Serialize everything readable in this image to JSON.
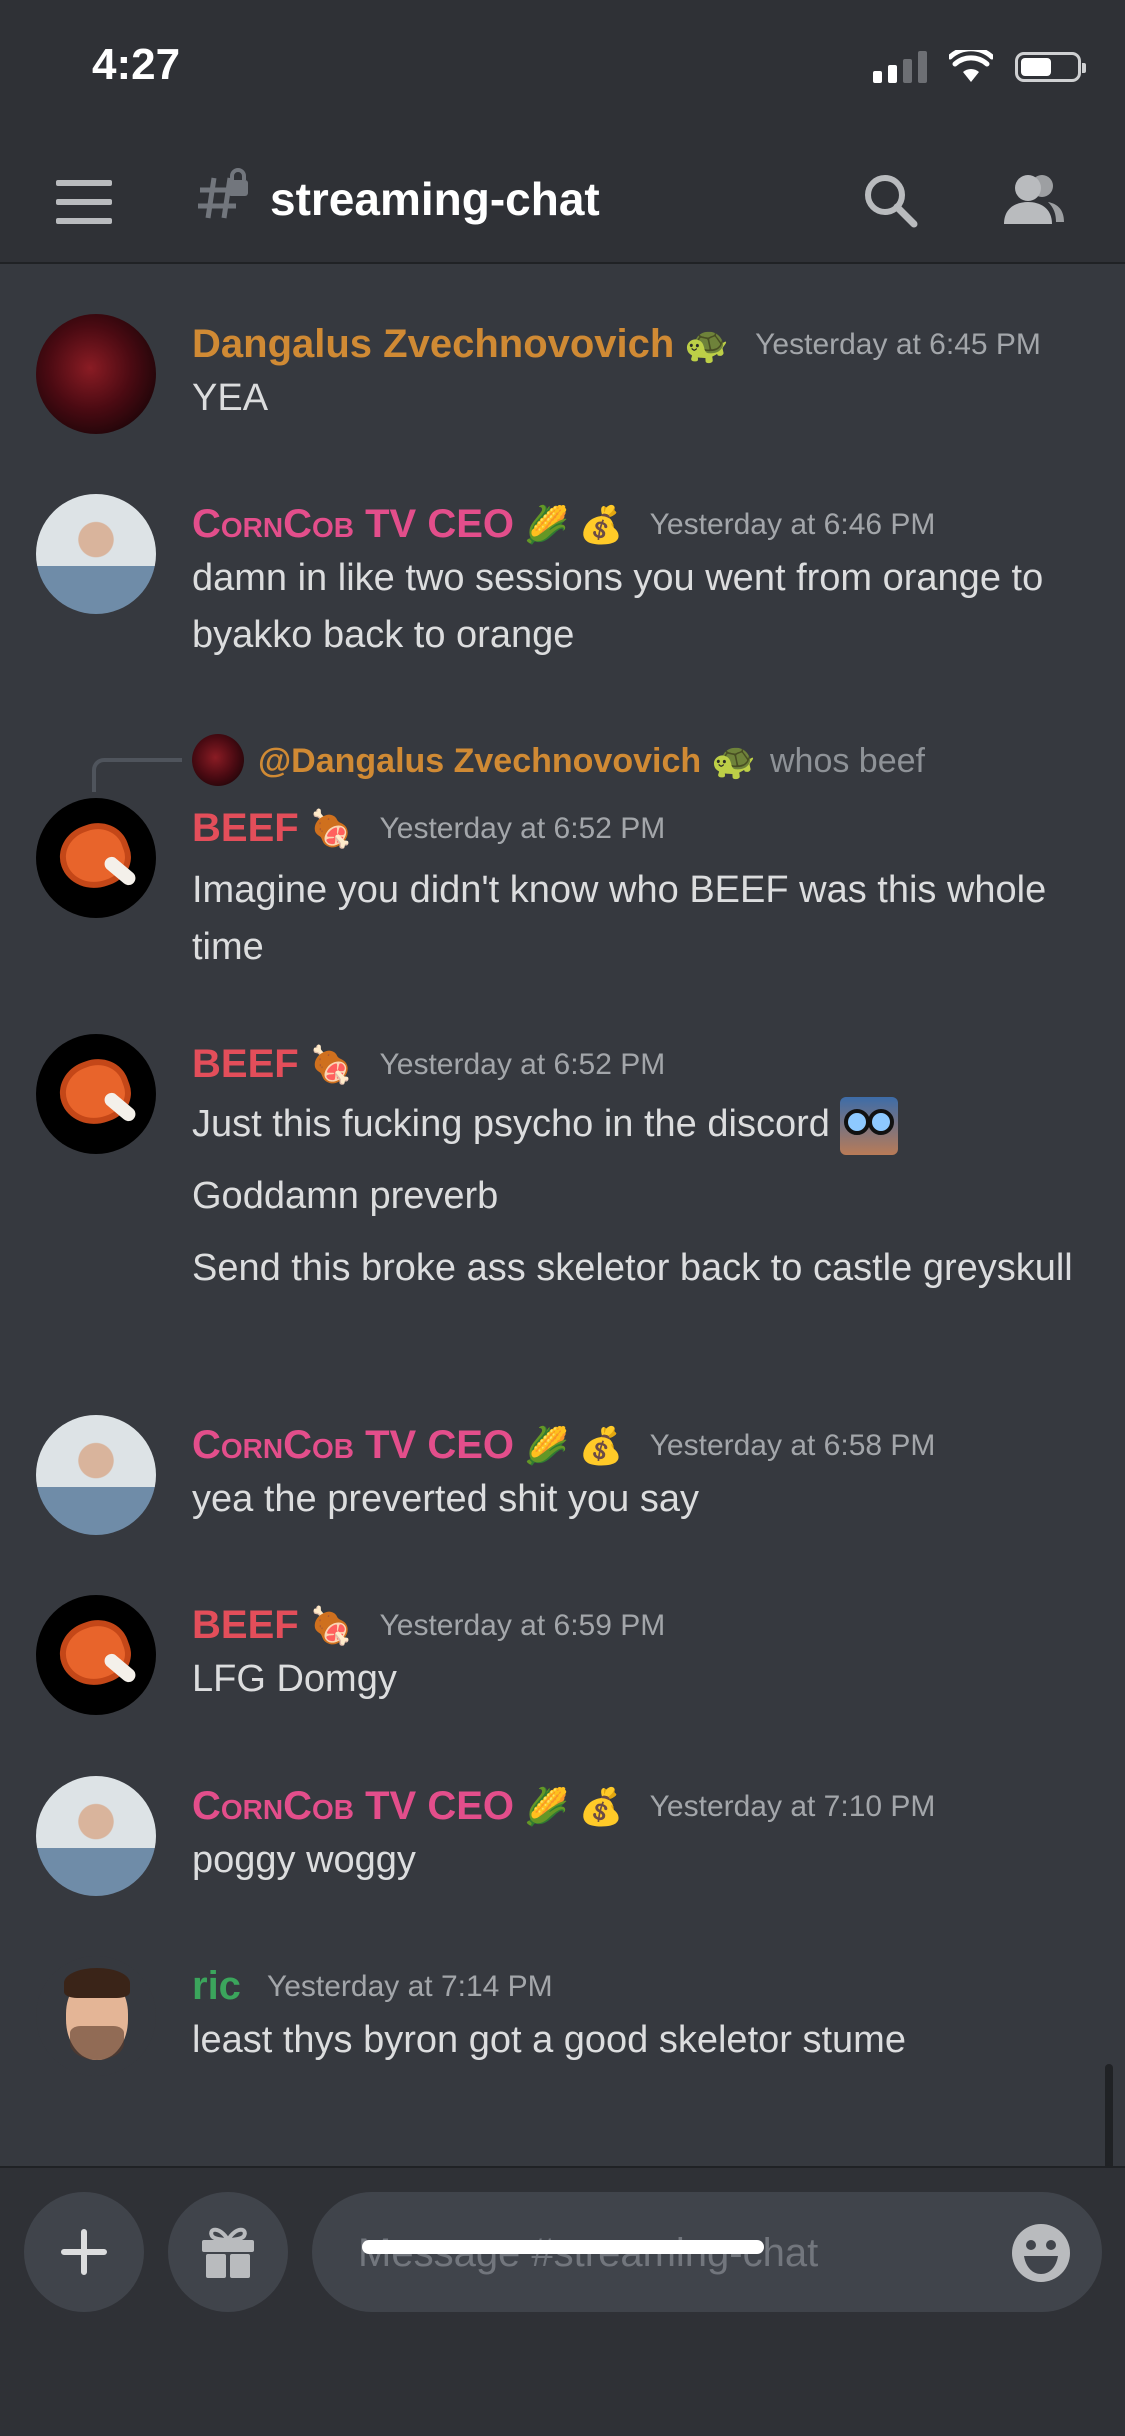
{
  "status_bar": {
    "time": "4:27"
  },
  "header": {
    "channel_name": "streaming-chat"
  },
  "messages": [
    {
      "username": "Dangalus Zvechnovovich",
      "badge": "🐢",
      "timestamp": "Yesterday at 6:45 PM",
      "lines": [
        "YEA"
      ]
    },
    {
      "username": "CornCob TV CEO",
      "badge": "🌽",
      "badge2": "💰",
      "timestamp": "Yesterday at 6:46 PM",
      "lines": [
        "damn in like two sessions you went from orange to byakko back to orange"
      ]
    },
    {
      "reply": {
        "mention": "@Dangalus Zvechnovovich",
        "badge": "🐢",
        "preview": "whos beef"
      },
      "username": "BEEF",
      "badge": "🍖",
      "timestamp": "Yesterday at 6:52 PM",
      "lines": [
        "Imagine you didn't know who BEEF was this whole time"
      ]
    },
    {
      "username": "BEEF",
      "badge": "🍖",
      "timestamp": "Yesterday at 6:52 PM",
      "lines": [
        "Just this fucking psycho in the discord",
        "Goddamn preverb",
        "Send this broke ass skeletor back to castle greyskull"
      ]
    },
    {
      "username": "CornCob TV CEO",
      "badge": "🌽",
      "badge2": "💰",
      "timestamp": "Yesterday at 6:58 PM",
      "lines": [
        "yea the preverted shit you say"
      ]
    },
    {
      "username": "BEEF",
      "badge": "🍖",
      "timestamp": "Yesterday at 6:59 PM",
      "lines": [
        "LFG Domgy"
      ]
    },
    {
      "username": "CornCob TV CEO",
      "badge": "🌽",
      "badge2": "💰",
      "timestamp": "Yesterday at 7:10 PM",
      "lines": [
        "poggy woggy"
      ]
    },
    {
      "username": "ric",
      "timestamp": "Yesterday at 7:14 PM",
      "lines": [
        "least thys byron got a good skeletor stume"
      ]
    }
  ],
  "composer": {
    "placeholder": "Message #streaming-chat"
  },
  "icons": [
    "menu-icon",
    "channel-lock-icon",
    "search-icon",
    "members-icon",
    "plus-icon",
    "gift-icon",
    "emoji-icon"
  ],
  "colors": {
    "background": "#36393f",
    "header": "#2f3136",
    "dangalus": "#d08a34",
    "corncob": "#e34e8b",
    "beef": "#e34e5a",
    "ric": "#3ba55c"
  }
}
